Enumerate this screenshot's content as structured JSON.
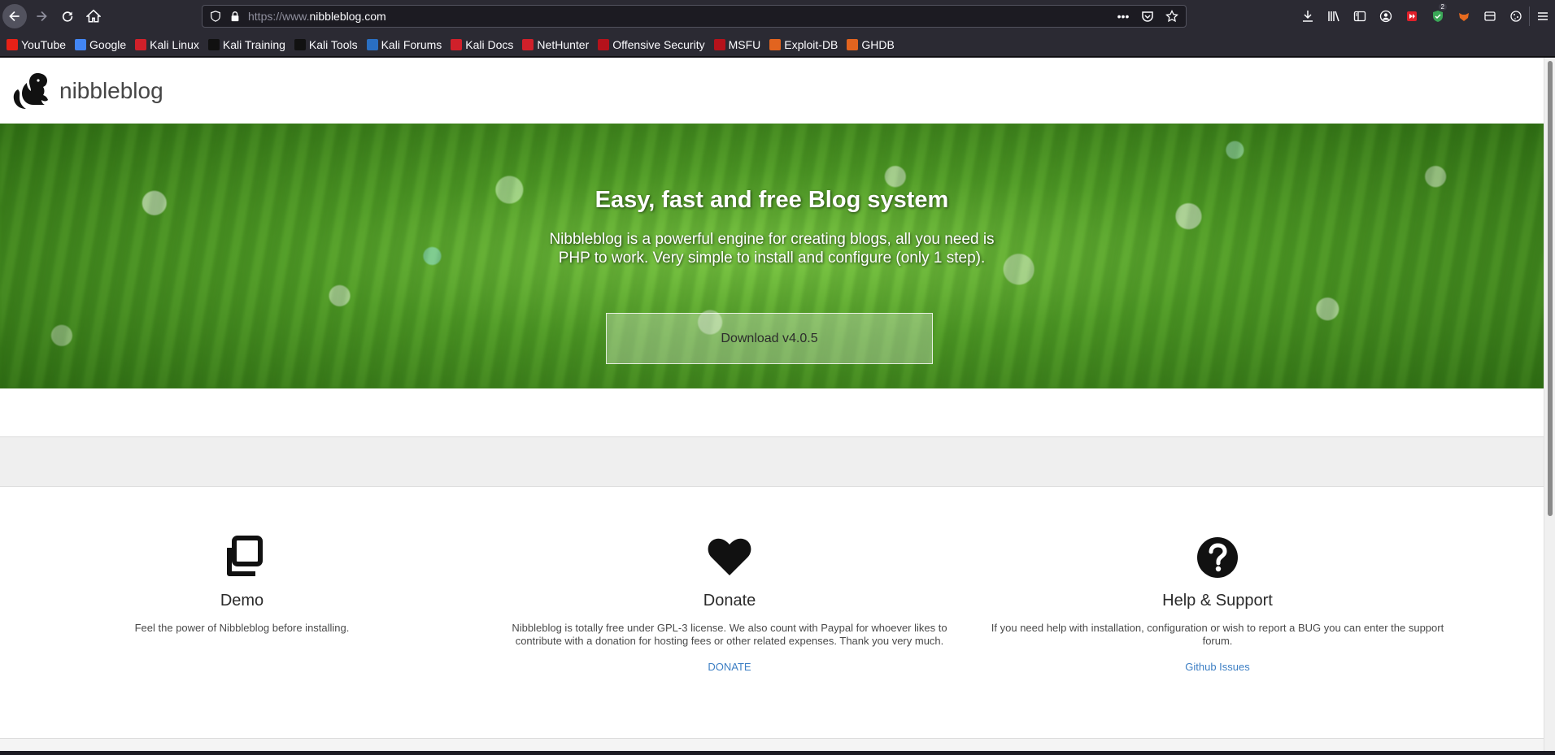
{
  "browser": {
    "url_prefix": "https://www.",
    "url_host": "nibbleblog.com",
    "extension_badge": "2",
    "bookmarks": [
      {
        "label": "YouTube",
        "color": "#e62117"
      },
      {
        "label": "Google",
        "color": "#4285f4"
      },
      {
        "label": "Kali Linux",
        "color": "#d0202a"
      },
      {
        "label": "Kali Training",
        "color": "#111111"
      },
      {
        "label": "Kali Tools",
        "color": "#111111"
      },
      {
        "label": "Kali Forums",
        "color": "#2a6fc2"
      },
      {
        "label": "Kali Docs",
        "color": "#d0202a"
      },
      {
        "label": "NetHunter",
        "color": "#d0202a"
      },
      {
        "label": "Offensive Security",
        "color": "#b5121b"
      },
      {
        "label": "MSFU",
        "color": "#b5121b"
      },
      {
        "label": "Exploit-DB",
        "color": "#e2641f"
      },
      {
        "label": "GHDB",
        "color": "#e2641f"
      }
    ]
  },
  "site": {
    "title": "nibbleblog"
  },
  "hero": {
    "title": "Easy, fast and free Blog system",
    "subtitle": "Nibbleblog is a powerful engine for creating blogs, all you need is PHP to work. Very simple to install and configure (only 1 step).",
    "download_label": "Download v4.0.5"
  },
  "features": {
    "demo": {
      "icon": "copy-icon",
      "title": "Demo",
      "text": "Feel the power of Nibbleblog before installing."
    },
    "donate": {
      "icon": "heart-icon",
      "title": "Donate",
      "text": "Nibbleblog is totally free under GPL-3 license. We also count with Paypal for whoever likes to contribute with a donation for hosting fees or other related expenses. Thank you very much.",
      "link": "DONATE"
    },
    "help": {
      "icon": "question-circle-icon",
      "title": "Help & Support",
      "text": "If you need help with installation, configuration or wish to report a BUG you can enter the support forum.",
      "link": "Github Issues"
    }
  }
}
